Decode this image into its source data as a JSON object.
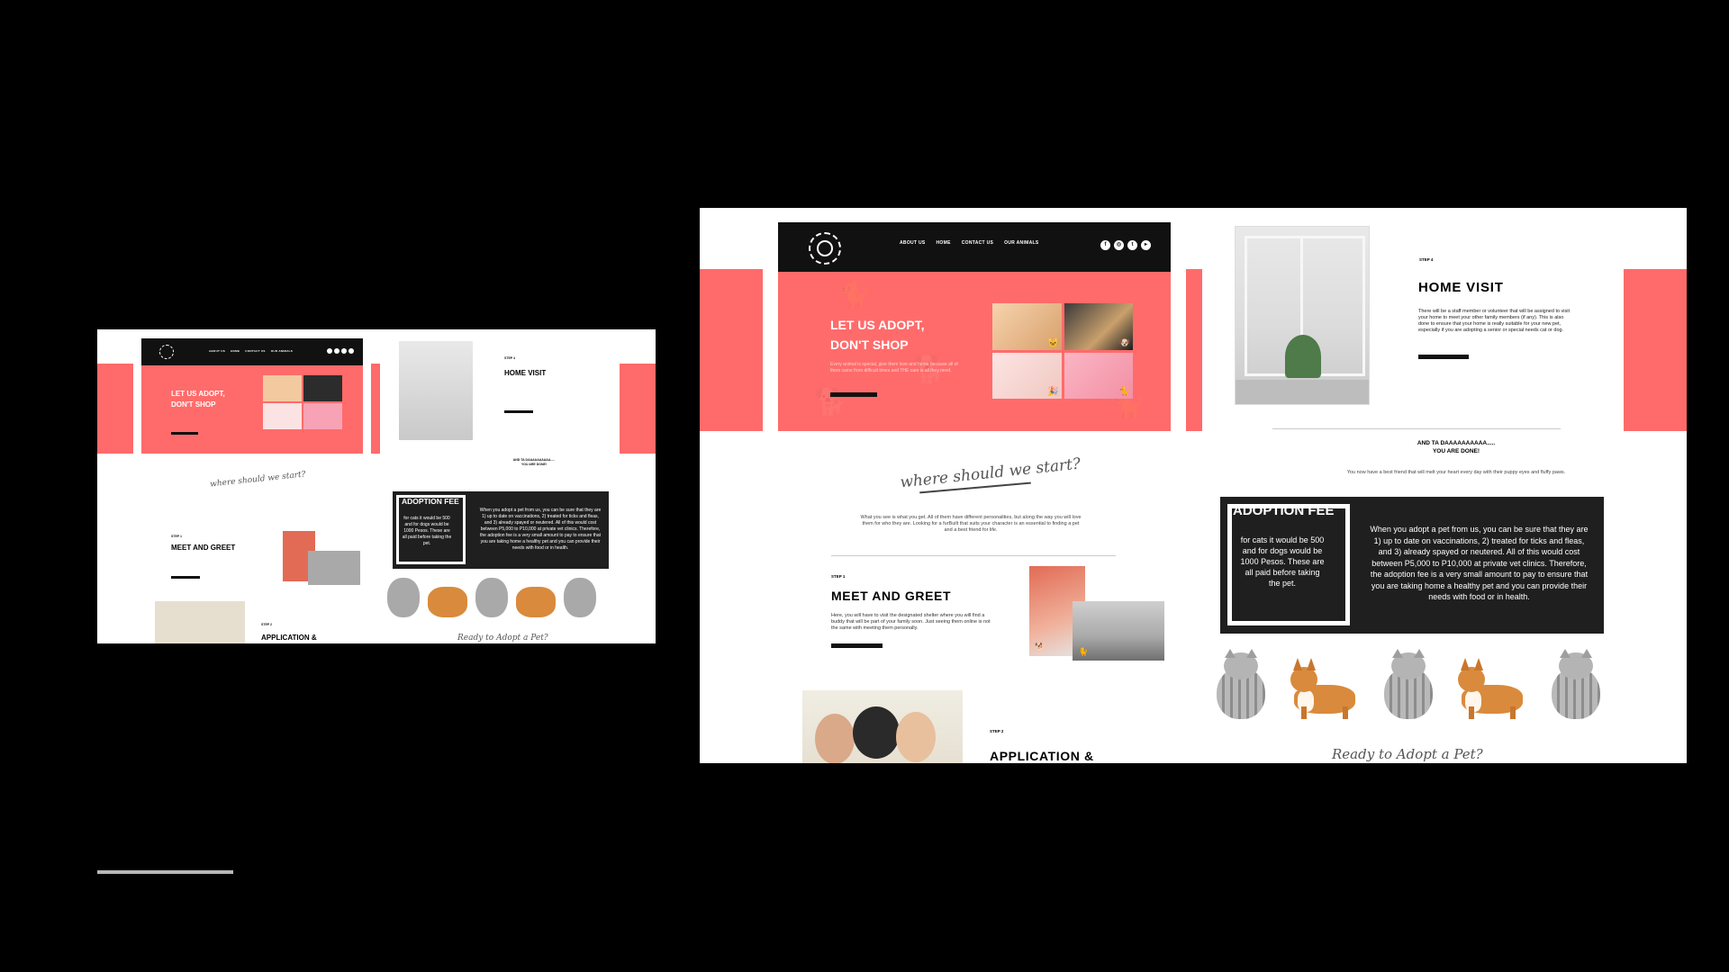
{
  "nav": {
    "links": [
      "ABOUT US",
      "HOME",
      "CONTACT US",
      "OUR ANIMALS"
    ],
    "socials": [
      "f",
      "ig",
      "t",
      "yt"
    ]
  },
  "hero": {
    "title_line1": "LET US ADOPT,",
    "title_line2": "DON'T SHOP",
    "text": "Every animal is special, give them love and home because all of them came from difficult times and THE care is all they need."
  },
  "home_visit": {
    "step": "STEP 4",
    "title": "HOME VISIT",
    "text": "There will be a staff member or volunteer that will be assigned to visit your home to meet your other family members (if any). This is also done to ensure that your home is really suitable for your new pet, especially if you are adopting a senior or special needs cat or dog."
  },
  "done": {
    "line1": "AND TA DAAAAAAAAAA.....",
    "line2": "YOU ARE DONE!",
    "text": "You now have a best friend that will melt your heart every day with their puppy eyes and fluffy paws."
  },
  "where": {
    "heading": "where should we start?",
    "text": "What you see is what you get. All of them have different personalities, but along the way you will love them for who they are. Looking for a furBuilt that suits your character is an essential to finding a pet and a best friend for life."
  },
  "meet": {
    "step": "STEP 1",
    "title": "MEET AND GREET",
    "text": "Here, you will have to visit the designated shelter where you will find a buddy that will be part of your family soon. Just seeing them online is not the same with meeting them personally."
  },
  "fee": {
    "title": "ADOPTION FEE",
    "left": "for cats it would be 500 and for dogs would be 1000 Pesos. These are all paid before taking the pet.",
    "right": "When you adopt a pet from us, you can be sure that they are 1) up to date on vaccinations, 2) treated for ticks and fleas, and 3) already spayed or neutered. All of this would cost between P5,000 to P10,000 at private vet clinics. Therefore, the adoption fee is a very small amount to pay to ensure that you are taking home a healthy pet and you can provide their needs with food or in health."
  },
  "application": {
    "step": "STEP 2",
    "title": "APPLICATION &"
  },
  "ready": {
    "heading": "Ready to Adopt a Pet?"
  },
  "colors": {
    "accent": "#FF6B6B",
    "dark": "#1f1f1f"
  }
}
